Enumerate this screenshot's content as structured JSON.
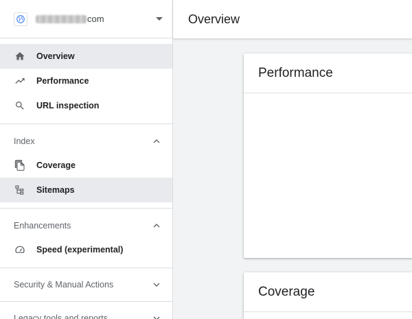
{
  "property": {
    "domain_suffix": "com"
  },
  "nav": {
    "overview": "Overview",
    "performance": "Performance",
    "url_inspection": "URL inspection"
  },
  "index": {
    "header": "Index",
    "coverage": "Coverage",
    "sitemaps": "Sitemaps"
  },
  "enhancements": {
    "header": "Enhancements",
    "speed": "Speed (experimental)"
  },
  "security": {
    "header": "Security & Manual Actions"
  },
  "legacy": {
    "header": "Legacy tools and reports"
  },
  "main": {
    "page_title": "Overview",
    "cards": {
      "performance_title": "Performance",
      "coverage_title": "Coverage"
    }
  },
  "colors": {
    "active_bg": "#e8eaed",
    "icon": "#5f6368",
    "divider": "#dadce0"
  }
}
